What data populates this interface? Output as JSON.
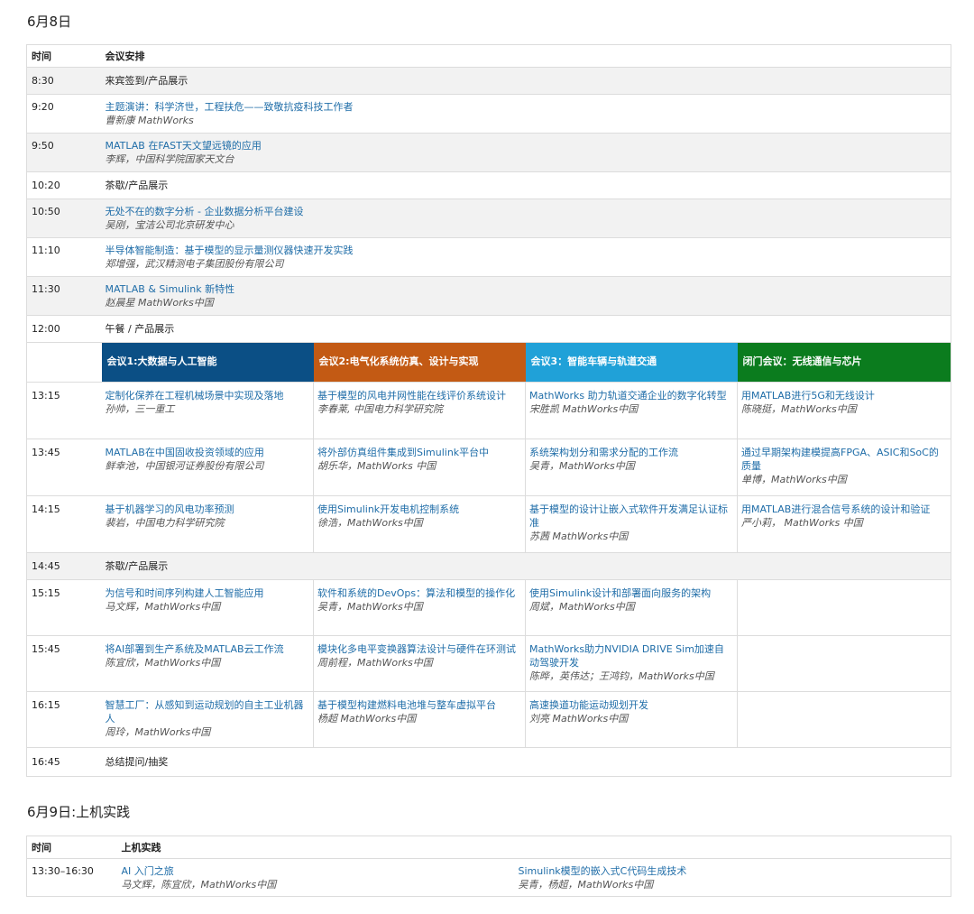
{
  "day1": {
    "title": "6月8日",
    "header": {
      "time": "时间",
      "agenda": "会议安排"
    },
    "rows_top": [
      {
        "time": "8:30",
        "text": "来宾签到/产品展示"
      },
      {
        "time": "9:20",
        "talk": "主题演讲：科学济世，工程扶危——致敬抗疫科技工作者",
        "speaker": "曹新康 MathWorks"
      },
      {
        "time": "9:50",
        "talk": "MATLAB 在FAST天文望远镜的应用",
        "speaker": "李辉，中国科学院国家天文台"
      },
      {
        "time": "10:20",
        "text": "茶歇/产品展示"
      },
      {
        "time": "10:50",
        "talk": "无处不在的数字分析 - 企业数据分析平台建设",
        "speaker": "吴刚，宝洁公司北京研发中心"
      },
      {
        "time": "11:10",
        "talk": "半导体智能制造：基于模型的显示量测仪器快速开发实践",
        "speaker": "郑增强，武汉精测电子集团股份有限公司"
      },
      {
        "time": "11:30",
        "talk": "MATLAB & Simulink 新特性",
        "speaker": "赵晨星 MathWorks中国"
      },
      {
        "time": "12:00",
        "text": "午餐 / 产品展示"
      }
    ],
    "tracks": [
      "会议1:大数据与人工智能",
      "会议2:电气化系统仿真、设计与实现",
      "会议3：智能车辆与轨道交通",
      "闭门会议：无线通信与芯片"
    ],
    "track_colors": [
      "#0b4f85",
      "#c35a14",
      "#20a1d8",
      "#0b7c1e"
    ],
    "session1": [
      {
        "time": "13:15",
        "cells": [
          {
            "talk": "定制化保养在工程机械场景中实现及落地",
            "speaker": "孙帅，三一重工"
          },
          {
            "talk": "基于模型的风电并网性能在线评价系统设计",
            "speaker": "李春莱, 中国电力科学研究院"
          },
          {
            "talk": "MathWorks 助力轨道交通企业的数字化转型",
            "speaker": "宋胜凯 MathWorks中国"
          },
          {
            "talk": "用MATLAB进行5G和无线设计",
            "speaker": "陈晓挺，MathWorks中国"
          }
        ]
      },
      {
        "time": "13:45",
        "cells": [
          {
            "talk": "MATLAB在中国固收投资领域的应用",
            "speaker": "鲜幸池，中国银河证券股份有限公司"
          },
          {
            "talk": "将外部仿真组件集成到Simulink平台中",
            "speaker": "胡乐华，MathWorks 中国"
          },
          {
            "talk": "系统架构划分和需求分配的工作流",
            "speaker": "吴青，MathWorks中国"
          },
          {
            "talk": "通过早期架构建模提高FPGA、ASIC和SoC的质量",
            "speaker": "单博，MathWorks中国"
          }
        ]
      },
      {
        "time": "14:15",
        "cells": [
          {
            "talk": "基于机器学习的风电功率预测",
            "speaker": "裴岩，中国电力科学研究院"
          },
          {
            "talk": "使用Simulink开发电机控制系统",
            "speaker": "徐浩，MathWorks中国"
          },
          {
            "talk": "基于模型的设计让嵌入式软件开发满足认证标准",
            "speaker": "苏茜 MathWorks中国"
          },
          {
            "talk": "用MATLAB进行混合信号系统的设计和验证",
            "speaker": "严小莉， MathWorks 中国"
          }
        ]
      }
    ],
    "break2": {
      "time": "14:45",
      "text": "茶歇/产品展示"
    },
    "session2": [
      {
        "time": "15:15",
        "cells": [
          {
            "talk": "为信号和时间序列构建人工智能应用",
            "speaker": "马文辉，MathWorks中国"
          },
          {
            "talk": "软件和系统的DevOps：算法和模型的操作化",
            "speaker": "吴青，MathWorks中国"
          },
          {
            "talk": "使用Simulink设计和部署面向服务的架构",
            "speaker": "周斌，MathWorks中国"
          },
          {
            "talk": "",
            "speaker": ""
          }
        ]
      },
      {
        "time": "15:45",
        "cells": [
          {
            "talk": "将AI部署到生产系统及MATLAB云工作流",
            "speaker": "陈宜欣，MathWorks中国"
          },
          {
            "talk": "模块化多电平变换器算法设计与硬件在环测试",
            "speaker": "周前程，MathWorks中国"
          },
          {
            "talk": "MathWorks助力NVIDIA DRIVE Sim加速自动驾驶开发",
            "speaker": "陈晔，英伟达；王鸿钧，MathWorks中国"
          },
          {
            "talk": "",
            "speaker": ""
          }
        ]
      },
      {
        "time": "16:15",
        "cells": [
          {
            "talk": "智慧工厂：从感知到运动规划的自主工业机器人",
            "speaker": "周玲，MathWorks中国"
          },
          {
            "talk": "基于模型构建燃料电池堆与整车虚拟平台",
            "speaker": "杨超 MathWorks中国"
          },
          {
            "talk": "高速换道功能运动规划开发",
            "speaker": "刘亮 MathWorks中国"
          },
          {
            "talk": "",
            "speaker": ""
          }
        ]
      }
    ],
    "closing": {
      "time": "16:45",
      "text": "总结提问/抽奖"
    }
  },
  "day2": {
    "title": "6月9日:上机实践",
    "header": {
      "time": "时间",
      "agenda": "上机实践"
    },
    "row": {
      "time": "13:30–16:30",
      "cells": [
        {
          "talk": "AI 入门之旅",
          "speaker": "马文辉，陈宜欣，MathWorks中国"
        },
        {
          "talk": "Simulink模型的嵌入式C代码生成技术",
          "speaker": "吴青，杨超，MathWorks中国"
        }
      ]
    }
  }
}
